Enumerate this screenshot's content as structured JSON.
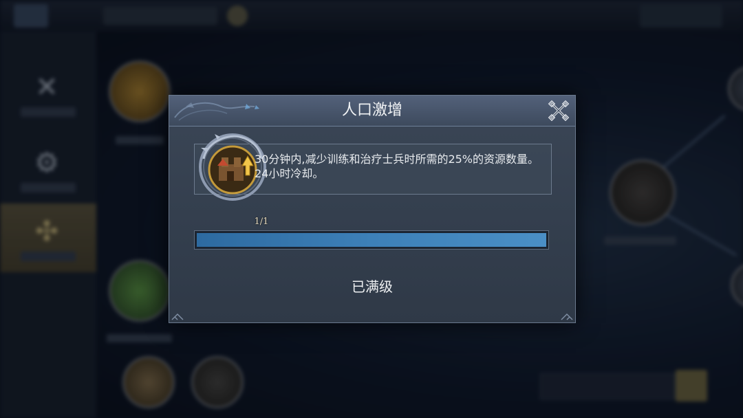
{
  "dialog": {
    "title": "人口激增",
    "description": "30分钟内,减少训练和治疗士兵时所需的25%的资源数量。24小时冷却。",
    "skill_level": "1/1",
    "progress_fraction": 1.0,
    "status": "已满级",
    "close_icon": "close-x-icon",
    "skill_icon": "castle-upgrade-icon"
  },
  "colors": {
    "dialog_bg": "#36414f",
    "header_bg": "#4a576c",
    "progress_fill": "#3d80b8",
    "text": "#eef0f2"
  }
}
